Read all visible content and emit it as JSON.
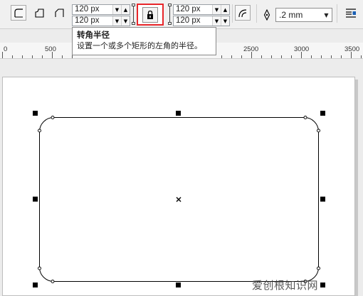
{
  "toolbar": {
    "radius_top_left": "120 px",
    "radius_bottom_left": "120 px",
    "radius_top_right": "120 px",
    "radius_bottom_right": "120 px",
    "outline_width": ".2 mm"
  },
  "tooltip": {
    "title": "转角半径",
    "description": "设置一个或多个矩形的左角的半径。"
  },
  "ruler": {
    "labels": [
      "0",
      "500",
      "2500",
      "3000",
      "3500"
    ]
  },
  "watermark": "爱创根知识网",
  "colors": {
    "highlight": "#e8262a",
    "selection_handle": "#000000"
  }
}
